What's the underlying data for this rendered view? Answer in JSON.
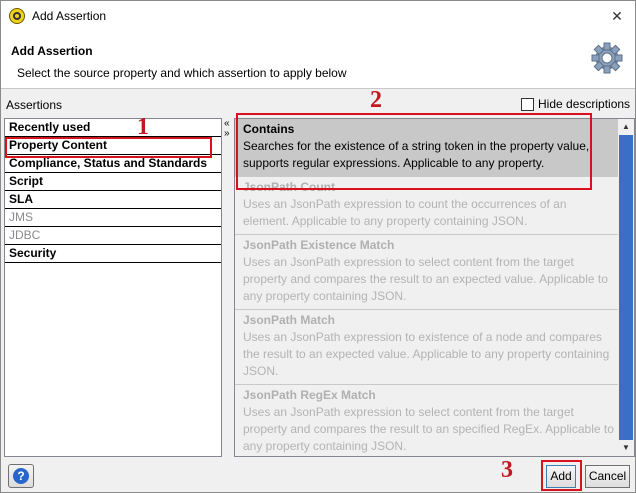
{
  "window": {
    "title": "Add Assertion",
    "close_glyph": "✕"
  },
  "header": {
    "title": "Add Assertion",
    "subtitle": "Select the source property and which assertion to apply below",
    "icon": "gear-icon"
  },
  "assertions_label": "Assertions",
  "hide_descriptions": {
    "label": "Hide descriptions",
    "checked": false
  },
  "categories": [
    {
      "label": "Recently used",
      "enabled": true
    },
    {
      "label": "Property Content",
      "enabled": true,
      "selected": true
    },
    {
      "label": "Compliance, Status and Standards",
      "enabled": true
    },
    {
      "label": "Script",
      "enabled": true
    },
    {
      "label": "SLA",
      "enabled": true
    },
    {
      "label": "JMS",
      "enabled": false
    },
    {
      "label": "JDBC",
      "enabled": false
    },
    {
      "label": "Security",
      "enabled": true
    }
  ],
  "assertion_items": [
    {
      "name": "Contains",
      "desc": "Searches for the existence of a string token in the property value, supports regular expressions. Applicable to any property.",
      "enabled": true,
      "selected": true
    },
    {
      "name": "JsonPath Count",
      "desc": "Uses an JsonPath expression to count the occurrences of an element. Applicable to any property containing JSON.",
      "enabled": false
    },
    {
      "name": "JsonPath Existence Match",
      "desc": "Uses an JsonPath expression to select content from the target property and compares the result to an expected value. Applicable to any property containing JSON.",
      "enabled": false
    },
    {
      "name": "JsonPath Match",
      "desc": "Uses an JsonPath expression to existence of a node and compares the result to an expected value. Applicable to any property containing JSON.",
      "enabled": false
    },
    {
      "name": "JsonPath RegEx Match",
      "desc": "Uses an JsonPath expression to select content from the target property and compares the result to an specified RegEx. Applicable to any property containing JSON.",
      "enabled": false
    }
  ],
  "annotations": {
    "one": "1",
    "two": "2",
    "three": "3"
  },
  "footer": {
    "help_glyph": "?",
    "add_label": "Add",
    "cancel_label": "Cancel"
  },
  "colors": {
    "annotation_red": "#c2181f",
    "scroll_thumb": "#3a6fc7",
    "selected_item": "#c8c8c8"
  }
}
